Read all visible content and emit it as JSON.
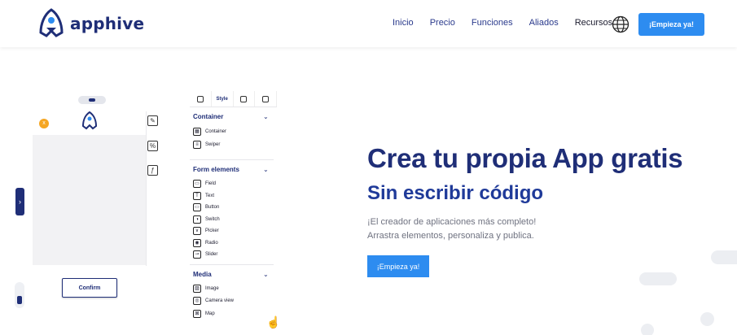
{
  "brand": {
    "name": "apphive",
    "color": "#1f2e77",
    "accent": "#2d8cf0"
  },
  "nav": {
    "items": [
      "Inicio",
      "Precio",
      "Funciones",
      "Aliados",
      "Recursos"
    ],
    "globe_icon": "globe-icon",
    "cta": "¡Empieza ya!"
  },
  "builder": {
    "badge": "x",
    "confirm_label": "Confirm",
    "side_icons": [
      "edit-icon",
      "percent-icon",
      "function-icon"
    ],
    "tabs": [
      "add-icon",
      "Style",
      "list-icon",
      "image-icon"
    ],
    "sections": [
      {
        "title": "Container",
        "items": [
          {
            "label": "Container",
            "icon": "container-icon"
          },
          {
            "label": "Swiper",
            "icon": "swiper-icon"
          }
        ]
      },
      {
        "title": "Form elements",
        "items": [
          {
            "label": "Field",
            "icon": "field-icon"
          },
          {
            "label": "Text",
            "icon": "text-icon"
          },
          {
            "label": "Button",
            "icon": "button-icon"
          },
          {
            "label": "Switch",
            "icon": "switch-icon"
          },
          {
            "label": "Picker",
            "icon": "picker-icon"
          },
          {
            "label": "Radio",
            "icon": "radio-icon"
          },
          {
            "label": "Slider",
            "icon": "slider-icon"
          }
        ]
      },
      {
        "title": "Media",
        "items": [
          {
            "label": "Image",
            "icon": "image-icon"
          },
          {
            "label": "Camera view",
            "icon": "camera-icon"
          },
          {
            "label": "Map",
            "icon": "map-icon"
          }
        ]
      }
    ]
  },
  "hero": {
    "title": "Crea tu propia App gratis",
    "subtitle": "Sin escribir código",
    "desc_line1": "¡El creador de aplicaciones más completo!",
    "desc_line2": "Arrastra elementos, personaliza y publica.",
    "cta": "¡Empieza ya!"
  }
}
